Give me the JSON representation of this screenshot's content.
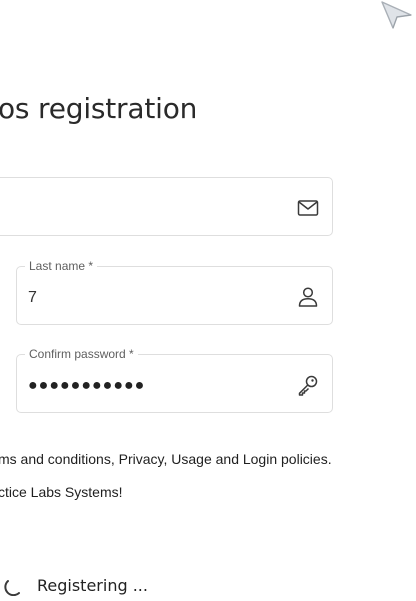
{
  "page": {
    "title": "os registration"
  },
  "form": {
    "email": {
      "value": "",
      "icon": "envelope-icon"
    },
    "last_name": {
      "label": "Last name *",
      "value": "7",
      "icon": "person-icon"
    },
    "confirm_password": {
      "label": "Confirm password *",
      "value": "●●●●●●●●●●●",
      "icon": "key-icon"
    }
  },
  "notices": {
    "policy": "ms and conditions, Privacy, Usage and Login policies.",
    "welcome": "ctice Labs Systems!"
  },
  "status": {
    "text": "Registering ...",
    "icon": "spinner-icon"
  },
  "cursor": {
    "icon": "mouse-pointer-icon"
  }
}
